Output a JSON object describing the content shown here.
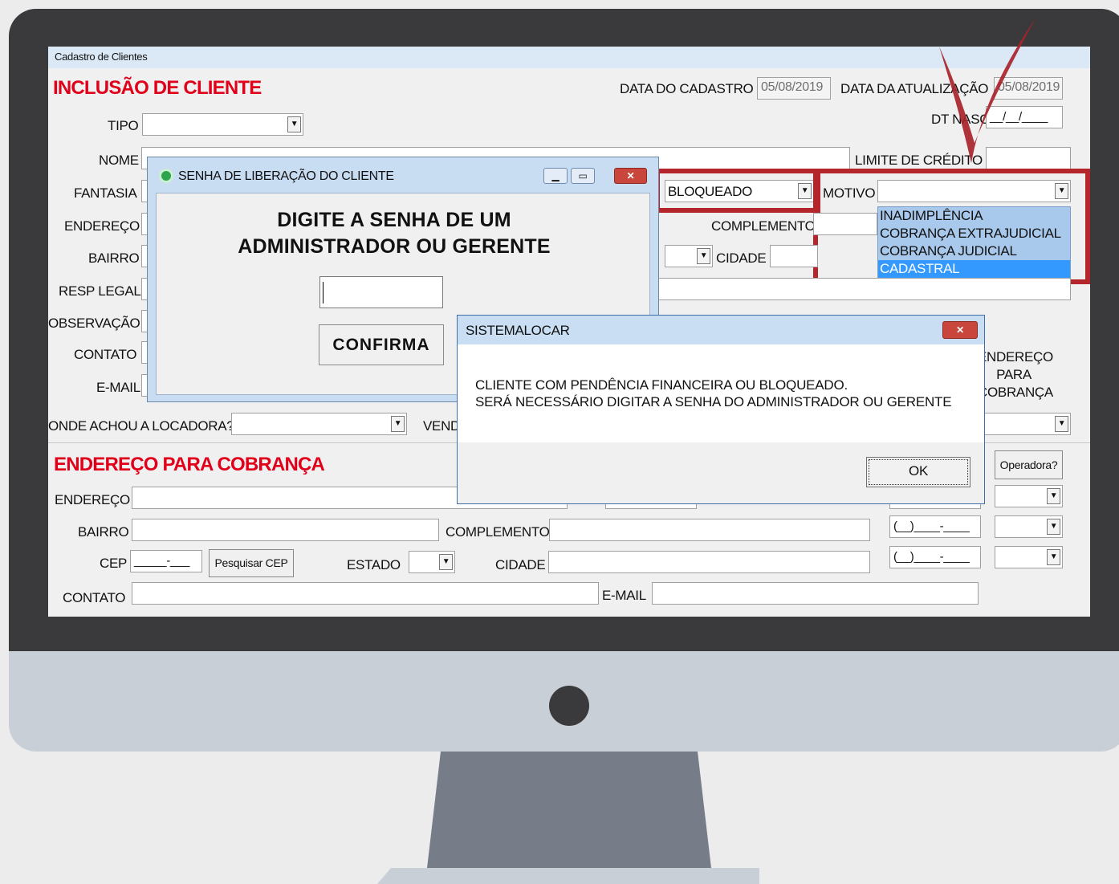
{
  "window": {
    "title": "Cadastro de Clientes"
  },
  "form": {
    "heading": "INCLUSÃO DE CLIENTE",
    "data_cadastro_label": "DATA DO CADASTRO",
    "data_cadastro_value": "05/08/2019",
    "data_atualizacao_label": "DATA DA ATUALIZAÇÃO",
    "data_atualizacao_value": "05/08/2019",
    "tipo_label": "TIPO",
    "dt_nasc_label": "DT NASC",
    "dt_nasc_mask": "__/__/____",
    "nome_label": "NOME",
    "limite_credito_label": "LIMITE DE CRÉDITO",
    "fantasia_label": "FANTASIA",
    "status_value": "BLOQUEADO",
    "motivo_label": "MOTIVO",
    "motivo_options": [
      "INADIMPLÊNCIA",
      "COBRANÇA EXTRAJUDICIAL",
      "COBRANÇA JUDICIAL",
      "CADASTRAL"
    ],
    "endereco_label": "ENDEREÇO",
    "complemento_label": "COMPLEMENTO",
    "bairro_label": "BAIRRO",
    "cidade_label": "CIDADE",
    "resp_legal_label": "RESP LEGAL",
    "observacao_label": "OBSERVAÇÃO",
    "contato_label": "CONTATO",
    "email_label": "E-MAIL",
    "endereco_para_cobranca_label": "ENDEREÇO PARA COBRANÇA",
    "onde_achou_label": "ONDE ACHOU A LOCADORA?",
    "vendedor_label_partial": "VEND"
  },
  "billing": {
    "heading": "ENDEREÇO PARA COBRANÇA",
    "endereco_label": "ENDEREÇO",
    "bairro_label": "BAIRRO",
    "complemento_label": "COMPLEMENTO",
    "cep_label": "CEP",
    "cep_mask": "_____-___",
    "pesquisar_cep_label": "Pesquisar CEP",
    "estado_label": "ESTADO",
    "cidade_label": "CIDADE",
    "contato_label": "CONTATO",
    "email_label": "E-MAIL",
    "operadora_label": "Operadora?",
    "phone_mask": "(__)____-____"
  },
  "password_dialog": {
    "title": "SENHA DE LIBERAÇÃO DO CLIENTE",
    "message_line1": "DIGITE A SENHA DE UM",
    "message_line2": "ADMINISTRADOR OU GERENTE",
    "confirm_label": "CONFIRMA",
    "minimize_glyph": "▁",
    "maximize_glyph": "▭",
    "close_glyph": "✕"
  },
  "alert_dialog": {
    "title": "SISTEMALOCAR",
    "line1": "CLIENTE COM PENDÊNCIA FINANCEIRA OU BLOQUEADO.",
    "line2": "SERÁ NECESSÁRIO DIGITAR A SENHA DO ADMINISTRADOR OU GERENTE",
    "ok_label": "OK",
    "close_glyph": "✕"
  },
  "colors": {
    "heading_red": "#e0001a",
    "highlight_red": "#b5252c",
    "selection_blue": "#3399ff",
    "bezel": "#3a3a3c"
  }
}
